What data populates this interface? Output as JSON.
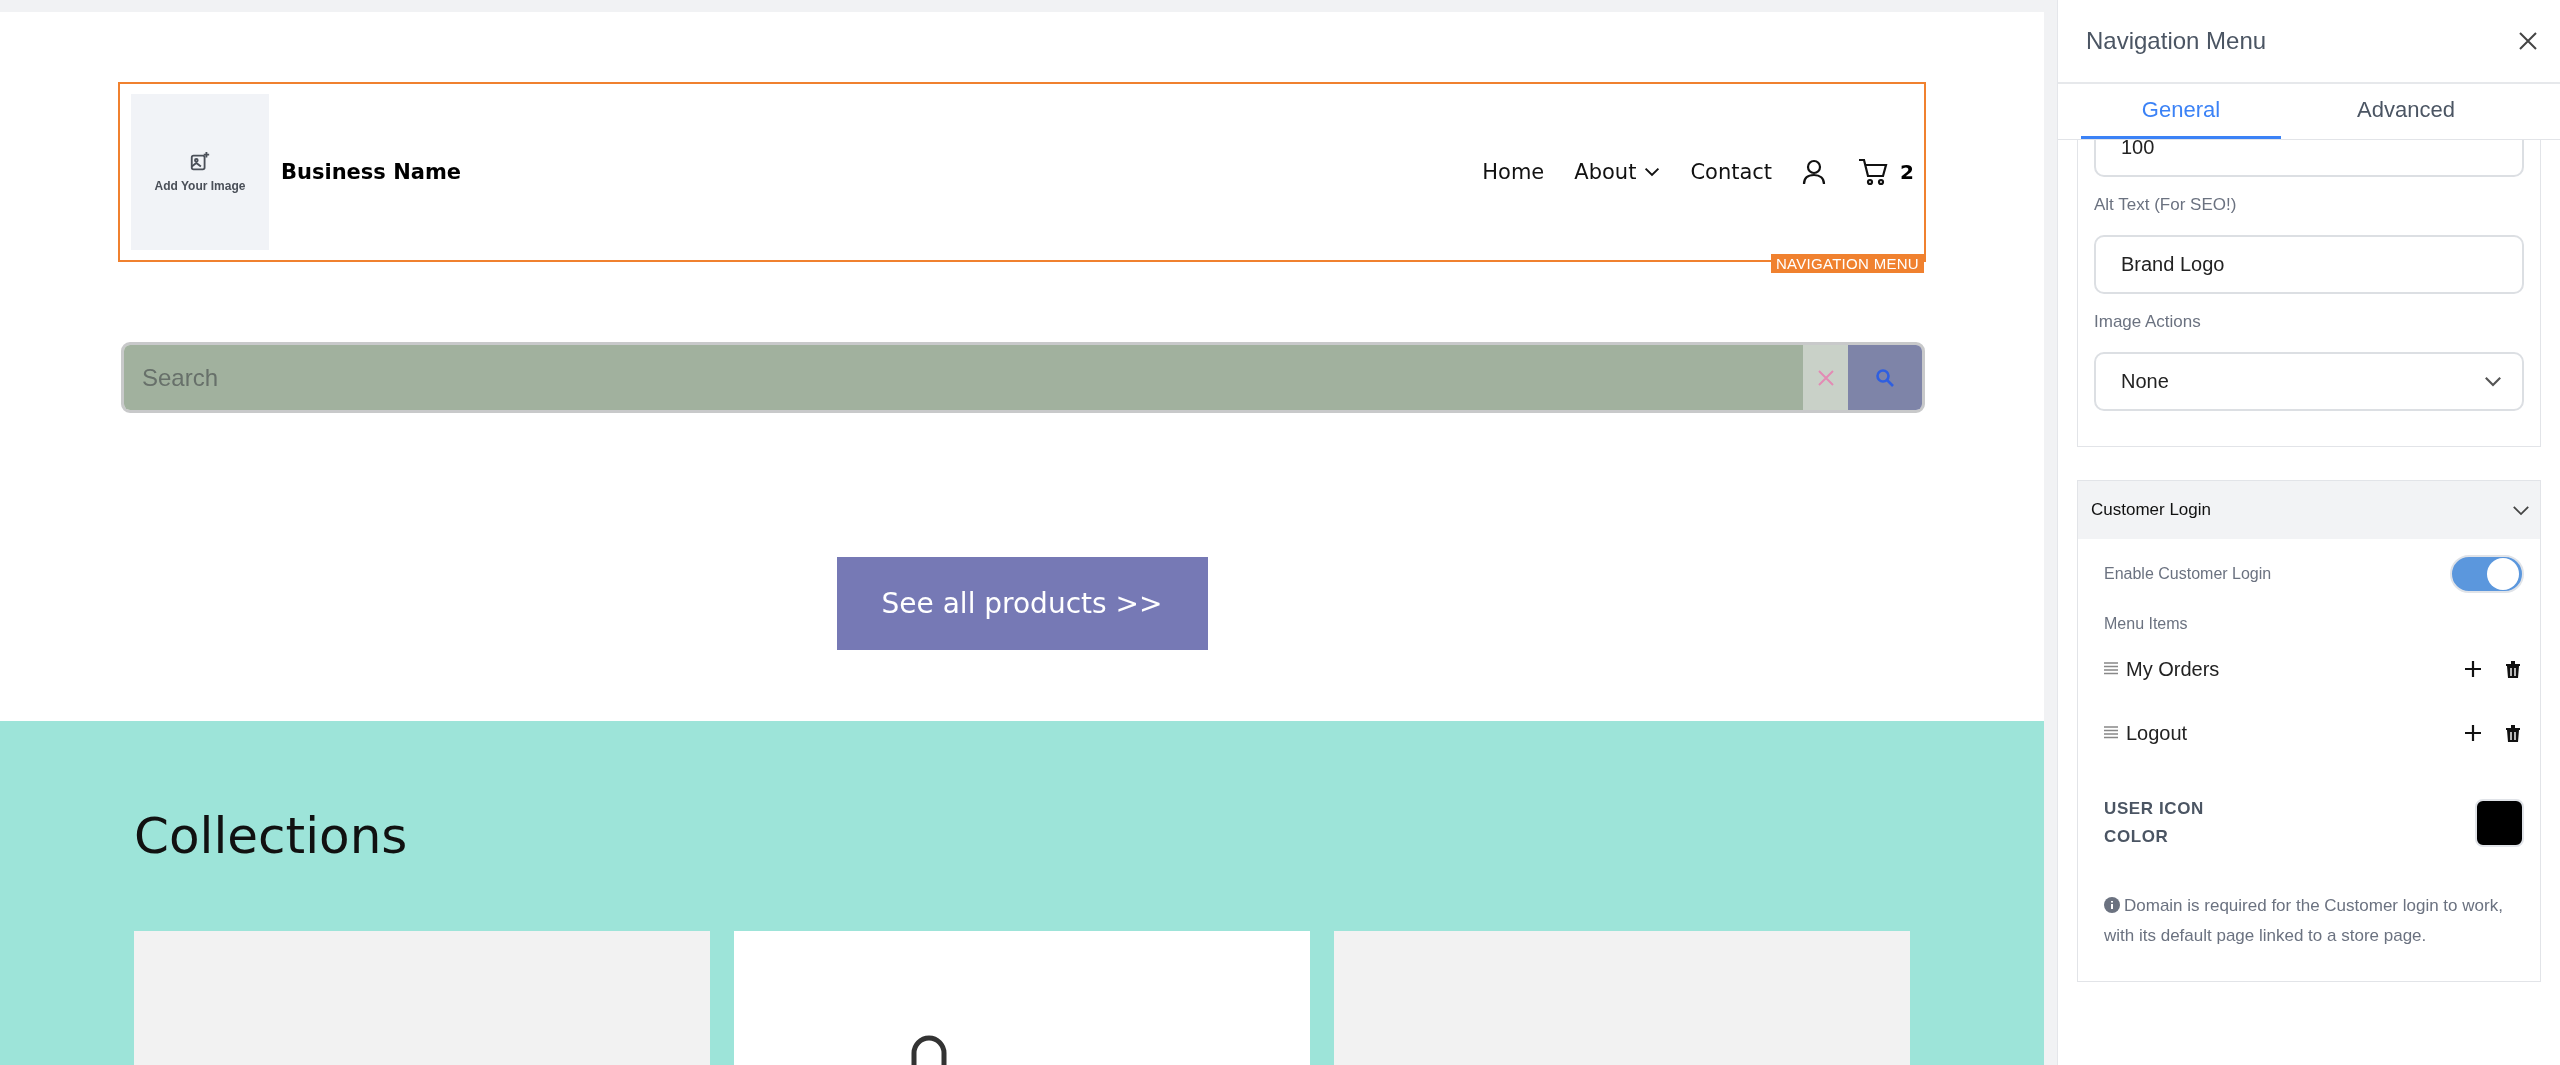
{
  "canvas": {
    "header": {
      "image_placeholder": "Add Your Image",
      "business_name": "Business Name",
      "nav_links": [
        {
          "label": "Home",
          "has_dropdown": false
        },
        {
          "label": "About",
          "has_dropdown": true
        },
        {
          "label": "Contact",
          "has_dropdown": false
        }
      ],
      "cart_count": "2",
      "selection_label": "NAVIGATION MENU"
    },
    "search": {
      "placeholder": "Search"
    },
    "cta_button": "See all products >>",
    "collections": {
      "title": "Collections",
      "cards": [
        {
          "kind": "empty"
        },
        {
          "kind": "icon"
        },
        {
          "kind": "empty"
        }
      ]
    }
  },
  "panel": {
    "title": "Navigation Menu",
    "tabs": [
      {
        "label": "General",
        "selected": true
      },
      {
        "label": "Advanced",
        "selected": false
      }
    ],
    "fields": [
      {
        "kind": "input",
        "value": "100"
      },
      {
        "kind": "input",
        "label": "Alt Text (For SEO!)",
        "value": "Brand Logo"
      },
      {
        "kind": "select",
        "label": "Image Actions",
        "value": "None"
      }
    ],
    "customer_login": {
      "title": "Customer Login",
      "expanded": true,
      "enable_label": "Enable Customer Login",
      "enabled": true,
      "menu_items_label": "Menu Items",
      "menu_items": [
        {
          "label": "My Orders"
        },
        {
          "label": "Logout"
        }
      ],
      "color_label": "USER ICON COLOR",
      "color": "#000000",
      "note": "Domain is required for the Customer login to work, with its default page linked to a store page."
    }
  }
}
